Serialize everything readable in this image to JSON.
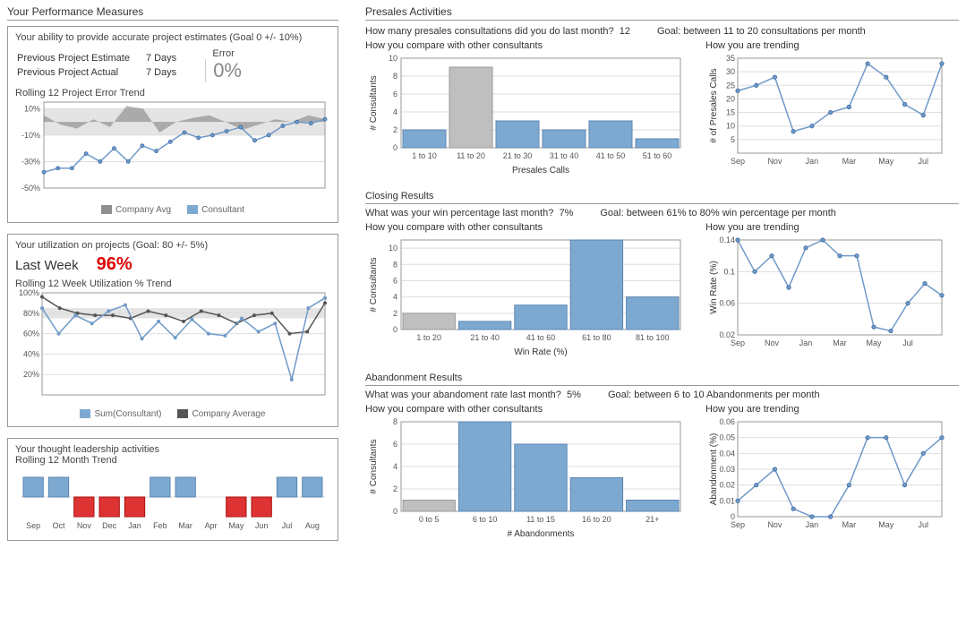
{
  "left_title": "Your Performance Measures",
  "right_title_presales": "Presales Activities",
  "right_title_closing": "Closing Results",
  "right_title_aband": "Abandonment Results",
  "estimate": {
    "title": "Your ability to provide accurate project estimates (Goal 0 +/- 10%)",
    "rows": [
      {
        "label": "Previous Project Estimate",
        "val": "7 Days"
      },
      {
        "label": "Previous Project Actual",
        "val": "7 Days"
      }
    ],
    "error_hdr": "Error",
    "error_val": "0%",
    "trend_hdr": "Rolling 12 Project Error Trend",
    "legend": [
      {
        "color": "#8f8f8f",
        "label": "Company Avg"
      },
      {
        "color": "#7da9d1",
        "label": "Consultant"
      }
    ]
  },
  "util": {
    "title": "Your utilization on projects (Goal: 80 +/- 5%)",
    "last_label": "Last Week",
    "last_val": "96%",
    "trend_hdr": "Rolling 12 Week Utilization % Trend",
    "legend": [
      {
        "color": "#7da9d1",
        "label": "Sum(Consultant)"
      },
      {
        "color": "#555555",
        "label": "Company Average"
      }
    ]
  },
  "thought": {
    "title": "Your thought leadership activities",
    "trend_hdr": "Rolling 12 Month Trend"
  },
  "presales": {
    "q": "How many presales consultations did you do last month?",
    "ans": "12",
    "goal": "Goal: between 11 to 20 consultations per month",
    "cmp_hdr": "How you compare with other consultants",
    "trend_hdr": "How you are trending",
    "hist_xlab": "Presales Calls",
    "hist_ylab": "# Consultants",
    "trend_ylab": "# of Presales Calls"
  },
  "closing": {
    "q": "What was your win percentage last month?",
    "ans": "7%",
    "goal": "Goal: between 61% to 80% win percentage per month",
    "cmp_hdr": "How you compare with other consultants",
    "trend_hdr": "How you are trending",
    "hist_xlab": "Win Rate (%)",
    "hist_ylab": "# Consultants",
    "trend_ylab": "Win Rate (%)"
  },
  "aband": {
    "q": "What was your abandoment rate last month?",
    "ans": "5%",
    "goal": "Goal: between 6 to 10 Abandonments per month",
    "cmp_hdr": "How you compare with other consultants",
    "trend_hdr": "How you are trending",
    "hist_xlab": "# Abandonments",
    "hist_ylab": "# Consultants",
    "trend_ylab": "Abandonment (%)"
  },
  "chart_data": [
    {
      "id": "estimate_trend",
      "type": "line",
      "title": "Rolling 12 Project Error Trend",
      "ylim": [
        -50,
        15
      ],
      "yticks": [
        10,
        -10,
        -30,
        -50
      ],
      "band": [
        -10,
        10
      ],
      "series": [
        {
          "name": "Company Avg",
          "kind": "area",
          "values": [
            5,
            -2,
            -5,
            2,
            -4,
            12,
            10,
            -8,
            0,
            3,
            5,
            0,
            -6,
            -2,
            2,
            0,
            5,
            2
          ]
        },
        {
          "name": "Consultant",
          "kind": "line",
          "values": [
            -38,
            -35,
            -35,
            -24,
            -30,
            -20,
            -30,
            -18,
            -22,
            -15,
            -8,
            -12,
            -10,
            -7,
            -4,
            -14,
            -10,
            -3,
            0,
            -1,
            2
          ]
        }
      ]
    },
    {
      "id": "util_trend",
      "type": "line",
      "title": "Rolling 12 Week Utilization % Trend",
      "ylim": [
        0,
        100
      ],
      "yticks": [
        100,
        80,
        60,
        40,
        20
      ],
      "band": [
        75,
        85
      ],
      "series": [
        {
          "name": "Company Average",
          "kind": "line-dark",
          "values": [
            96,
            85,
            80,
            78,
            78,
            75,
            82,
            78,
            72,
            82,
            78,
            70,
            78,
            80,
            60,
            62,
            90
          ]
        },
        {
          "name": "Sum(Consultant)",
          "kind": "line",
          "values": [
            85,
            60,
            78,
            70,
            82,
            88,
            55,
            72,
            56,
            74,
            60,
            58,
            75,
            62,
            70,
            15,
            85,
            95
          ]
        }
      ]
    },
    {
      "id": "thought_trend",
      "type": "bar",
      "categories": [
        "Sep",
        "Oct",
        "Nov",
        "Dec",
        "Jan",
        "Feb",
        "Mar",
        "Apr",
        "May",
        "Jun",
        "Jul",
        "Aug"
      ],
      "values": [
        1,
        1,
        -1,
        -1,
        -1,
        1,
        1,
        0,
        -1,
        -1,
        1,
        1
      ],
      "note": "+1 = blue bar above axis, -1 = red bar below axis, 0 = none"
    },
    {
      "id": "presales_hist",
      "type": "bar",
      "xlabel": "Presales Calls",
      "ylabel": "# Consultants",
      "ylim": [
        0,
        10
      ],
      "categories": [
        "1 to 10",
        "11 to 20",
        "21 to 30",
        "31 to 40",
        "41 to 50",
        "51 to 60"
      ],
      "values": [
        2,
        9,
        3,
        2,
        3,
        1
      ],
      "highlight_index": 1
    },
    {
      "id": "presales_trend",
      "type": "line",
      "ylabel": "# of Presales Calls",
      "ylim": [
        0,
        35
      ],
      "yticks": [
        5,
        10,
        15,
        20,
        25,
        30,
        35
      ],
      "categories": [
        "Sep",
        "Oct",
        "Nov",
        "Dec",
        "Jan",
        "Feb",
        "Mar",
        "Apr",
        "May",
        "Jun",
        "Jul",
        "Aug"
      ],
      "values": [
        23,
        25,
        28,
        8,
        10,
        15,
        17,
        33,
        28,
        18,
        14,
        33
      ]
    },
    {
      "id": "closing_hist",
      "type": "bar",
      "xlabel": "Win Rate (%)",
      "ylabel": "# Consultants",
      "ylim": [
        0,
        11
      ],
      "categories": [
        "1 to 20",
        "21 to 40",
        "41 to 60",
        "61 to 80",
        "81 to 100"
      ],
      "values": [
        2,
        1,
        3,
        11,
        4
      ],
      "highlight_index": 0
    },
    {
      "id": "closing_trend",
      "type": "line",
      "ylabel": "Win Rate (%)",
      "ylim": [
        0.02,
        0.14
      ],
      "yticks": [
        0.02,
        0.06,
        0.1,
        0.14
      ],
      "categories": [
        "Sep",
        "Oct",
        "Nov",
        "Dec",
        "Jan",
        "Feb",
        "Mar",
        "Apr",
        "May",
        "Jun",
        "Jul",
        "Aug"
      ],
      "values": [
        0.14,
        0.1,
        0.12,
        0.08,
        0.13,
        0.14,
        0.12,
        0.12,
        0.03,
        0.025,
        0.06,
        0.085,
        0.07
      ]
    },
    {
      "id": "aband_hist",
      "type": "bar",
      "xlabel": "# Abandonments",
      "ylabel": "# Consultants",
      "ylim": [
        0,
        8
      ],
      "categories": [
        "0 to 5",
        "6 to 10",
        "11 to 15",
        "16 to 20",
        "21+"
      ],
      "values": [
        1,
        8,
        6,
        3,
        1
      ],
      "highlight_index": 0
    },
    {
      "id": "aband_trend",
      "type": "line",
      "ylabel": "Abandonment (%)",
      "ylim": [
        0,
        0.06
      ],
      "yticks": [
        0,
        0.01,
        0.02,
        0.03,
        0.04,
        0.05,
        0.06
      ],
      "categories": [
        "Sep",
        "Oct",
        "Nov",
        "Dec",
        "Jan",
        "Feb",
        "Mar",
        "Apr",
        "May",
        "Jun",
        "Jul",
        "Aug"
      ],
      "values": [
        0.01,
        0.02,
        0.03,
        0.005,
        0.0,
        0.0,
        0.02,
        0.05,
        0.05,
        0.02,
        0.04,
        0.05
      ]
    }
  ]
}
